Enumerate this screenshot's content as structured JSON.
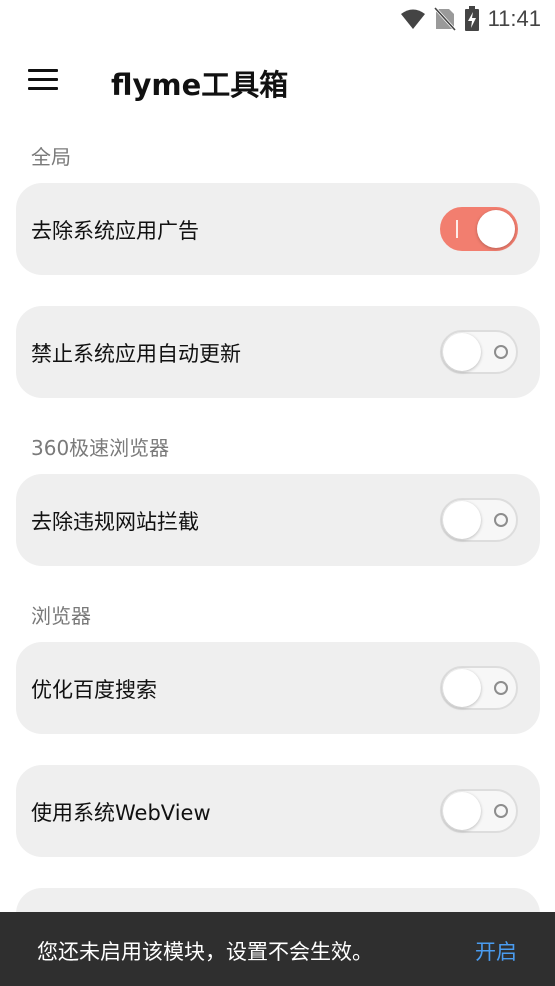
{
  "status_bar": {
    "time": "11:41",
    "icons": [
      "wifi-icon",
      "no-sim-icon",
      "battery-charging-icon"
    ]
  },
  "app_bar": {
    "menu_icon": "hamburger-menu-icon",
    "title": "flyme工具箱"
  },
  "sections": [
    {
      "header": "全局",
      "items": [
        {
          "label": "去除系统应用广告",
          "enabled": true
        },
        {
          "label": "禁止系统应用自动更新",
          "enabled": false
        }
      ]
    },
    {
      "header": "360极速浏览器",
      "items": [
        {
          "label": "去除违规网站拦截",
          "enabled": false
        }
      ]
    },
    {
      "header": "浏览器",
      "items": [
        {
          "label": "优化百度搜索",
          "enabled": false
        },
        {
          "label": "使用系统WebView",
          "enabled": false
        }
      ]
    }
  ],
  "snackbar": {
    "message": "您还未启用该模块，设置不会生效。",
    "action": "开启"
  },
  "colors": {
    "toggle_on": "#f27e6f",
    "card_bg": "#efefef",
    "snackbar_bg": "#2f2f2f",
    "snackbar_action": "#4a9cf0"
  }
}
